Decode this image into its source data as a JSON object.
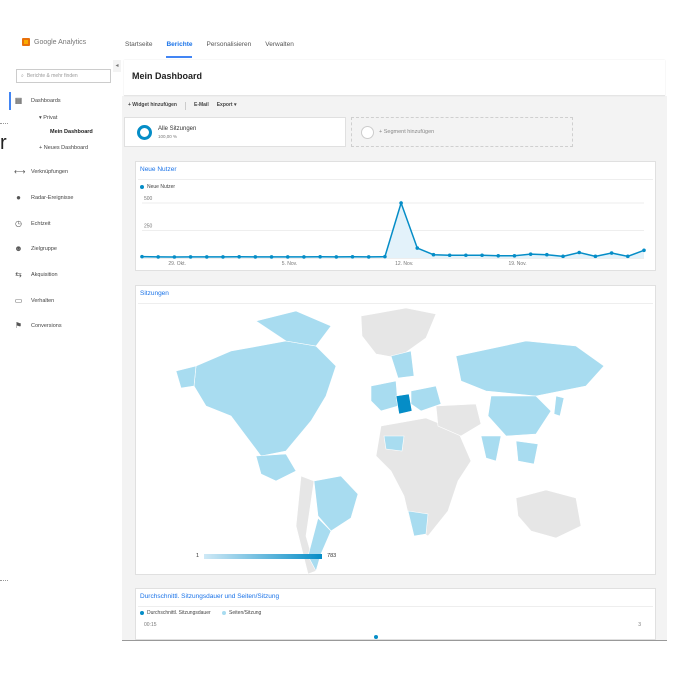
{
  "brand": {
    "name": "Google Analytics"
  },
  "topnav": {
    "tabs": [
      "Startseite",
      "Berichte",
      "Personalisieren",
      "Verwalten"
    ],
    "active_index": 1
  },
  "stray": {
    "glyph": "r"
  },
  "sidebar": {
    "search_placeholder": "Berichte & mehr finden",
    "dashboards": "Dashboards",
    "privat": "▾ Privat",
    "mein_dashboard": "Mein Dashboard",
    "neues_dashboard": "+ Neues Dashboard",
    "items": [
      {
        "label": "Verknüpfungen",
        "icon": "link-icon"
      },
      {
        "label": "Radar-Ereignisse",
        "icon": "pin-icon"
      },
      {
        "label": "Echtzeit",
        "icon": "clock-icon"
      },
      {
        "label": "Zielgruppe",
        "icon": "people-icon"
      },
      {
        "label": "Akquisition",
        "icon": "arrows-icon"
      },
      {
        "label": "Verhalten",
        "icon": "window-icon"
      },
      {
        "label": "Conversions",
        "icon": "flag-icon"
      }
    ]
  },
  "header": {
    "title": "Mein Dashboard"
  },
  "toolbar": {
    "add_widget": "+ Widget hinzufügen",
    "email": "E-Mail",
    "export": "Export ▾"
  },
  "segment": {
    "title": "Alle Sitzungen",
    "sub": "100,00 %",
    "add_label": "+ Segment hinzufügen"
  },
  "widgets": {
    "new_users": {
      "title": "Neue Nutzer",
      "legend": "Neue Nutzer"
    },
    "sessions": {
      "title": "Sitzungen",
      "scale_min": "1",
      "scale_max": "783"
    },
    "duration": {
      "title": "Durchschnittl. Sitzungsdauer und Seiten/Sitzung",
      "legend_a": "Durchschnittl. Sitzungsdauer",
      "legend_b": "Seiten/Sitzung",
      "left_tick": "00:15",
      "right_tick": "3"
    }
  },
  "chart_data": {
    "type": "area",
    "series": [
      {
        "name": "Neue Nutzer",
        "values": [
          12,
          10,
          9,
          10,
          10,
          10,
          11,
          10,
          10,
          10,
          10,
          11,
          10,
          11,
          10,
          12,
          500,
          90,
          30,
          25,
          25,
          25,
          20,
          20,
          35,
          30,
          15,
          50,
          15,
          45,
          15,
          70
        ]
      }
    ],
    "ytick_labels": [
      "500",
      "250"
    ],
    "xtick_labels": [
      "29. Okt.",
      "5. Nov.",
      "12. Nov.",
      "19. Nov."
    ],
    "ylim": [
      0,
      600
    ],
    "grid": true,
    "colors": {
      "line": "#058dc7",
      "fill": "#e3f2fa"
    }
  }
}
